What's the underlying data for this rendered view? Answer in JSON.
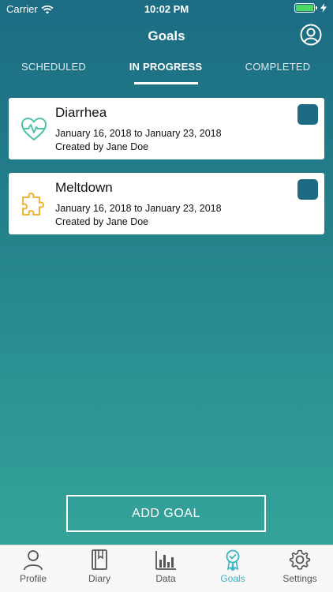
{
  "status_bar": {
    "carrier": "Carrier",
    "time": "10:02 PM"
  },
  "nav": {
    "title": "Goals"
  },
  "tabs": [
    {
      "label": "SCHEDULED",
      "active": false
    },
    {
      "label": "IN PROGRESS",
      "active": true
    },
    {
      "label": "COMPLETED",
      "active": false
    }
  ],
  "goals": [
    {
      "title": "Diarrhea",
      "dates": "January 16, 2018 to January 23, 2018",
      "creator": "Created by Jane Doe",
      "icon": "heart-pulse-icon",
      "icon_color": "#4fc3a9"
    },
    {
      "title": "Meltdown",
      "dates": "January 16, 2018 to January 23, 2018",
      "creator": "Created by Jane Doe",
      "icon": "puzzle-piece-icon",
      "icon_color": "#f2b233"
    }
  ],
  "add_goal_label": "ADD GOAL",
  "tabbar": [
    {
      "label": "Profile",
      "icon": "person-icon",
      "active": false
    },
    {
      "label": "Diary",
      "icon": "book-icon",
      "active": false
    },
    {
      "label": "Data",
      "icon": "bar-chart-icon",
      "active": false
    },
    {
      "label": "Goals",
      "icon": "award-ribbon-icon",
      "active": true
    },
    {
      "label": "Settings",
      "icon": "gear-icon",
      "active": false
    }
  ],
  "colors": {
    "accent": "#3ab4c4",
    "checkbox": "#1e6a83",
    "gradient_top": "#1c6c83",
    "gradient_bottom": "#34a49a"
  }
}
